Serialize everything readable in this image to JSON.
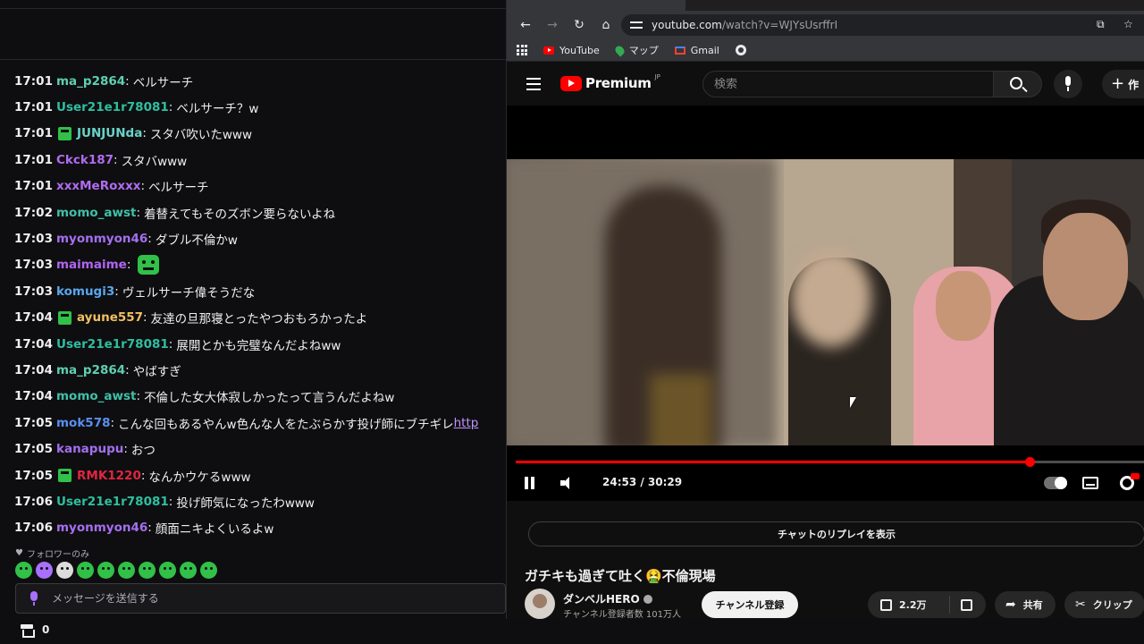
{
  "chat": {
    "messages": [
      {
        "time": "17:01",
        "user": "ma_p2864",
        "color": "#5fcfb0",
        "text": "ベルサーチ",
        "badge": false
      },
      {
        "time": "17:01",
        "user": "User21e1r78081",
        "color": "#2fbfa0",
        "text": "ベルサーチ？w",
        "badge": false
      },
      {
        "time": "17:01",
        "user": "JUNJUNda",
        "color": "#68d3c8",
        "text": "スタバ吹いたwww",
        "badge": true
      },
      {
        "time": "17:01",
        "user": "Ckck187",
        "color": "#b06cf0",
        "text": "スタバwww",
        "badge": false
      },
      {
        "time": "17:01",
        "user": "xxxMeRoxxx",
        "color": "#b06cf0",
        "text": "ベルサーチ",
        "badge": false
      },
      {
        "time": "17:02",
        "user": "momo_awst",
        "color": "#3fc0a8",
        "text": "着替えてもそのズボン要らないよね",
        "badge": false
      },
      {
        "time": "17:03",
        "user": "myonmyon46",
        "color": "#a56ff0",
        "text": "ダブル不倫かw",
        "badge": false
      },
      {
        "time": "17:03",
        "user": "maimaime",
        "color": "#b066f0",
        "text": "",
        "badge": false,
        "emote": true
      },
      {
        "time": "17:03",
        "user": "komugi3",
        "color": "#5aa7f0",
        "text": "ヴェルサーチ偉そうだな",
        "badge": false
      },
      {
        "time": "17:04",
        "user": "ayune557",
        "color": "#f0c060",
        "text": "友達の旦那寝とったやつおもろかったよ",
        "badge": true
      },
      {
        "time": "17:04",
        "user": "User21e1r78081",
        "color": "#2fbfa0",
        "text": "展開とかも完璧なんだよねww",
        "badge": false
      },
      {
        "time": "17:04",
        "user": "ma_p2864",
        "color": "#5fcfb0",
        "text": "やばすぎ",
        "badge": false
      },
      {
        "time": "17:04",
        "user": "momo_awst",
        "color": "#3fc0a8",
        "text": "不倫した女大体寂しかったって言うんだよねw",
        "badge": false
      },
      {
        "time": "17:05",
        "user": "mok578",
        "color": "#5a8ff0",
        "text": "こんな回もあるやんw色んな人をたぶらかす投げ師にブチギレ",
        "link": "http",
        "badge": false
      },
      {
        "time": "17:05",
        "user": "kanapupu",
        "color": "#a56ff0",
        "text": "おつ",
        "badge": false
      },
      {
        "time": "17:05",
        "user": "RMK1220",
        "color": "#e0263e",
        "text": "なんかウケるwww",
        "badge": true
      },
      {
        "time": "17:06",
        "user": "User21e1r78081",
        "color": "#2fbfa0",
        "text": "投げ師気になったわwww",
        "badge": false
      },
      {
        "time": "17:06",
        "user": "myonmyon46",
        "color": "#a56ff0",
        "text": "顔面ニキよくいるよw",
        "badge": false
      }
    ],
    "follower_only": "フォロワーのみ",
    "input_placeholder": "メッセージを送信する",
    "points": "0"
  },
  "browser": {
    "url_host": "youtube.com",
    "url_path": "/watch?v=WJYsUsrffrI",
    "bookmarks": [
      "YouTube",
      "マップ",
      "Gmail"
    ]
  },
  "youtube": {
    "logo_text": "Premium",
    "logo_region": "JP",
    "search_placeholder": "検索",
    "create_label": "作",
    "time_display": "24:53 / 30:29",
    "progress": 0.8162,
    "chat_replay_label": "チャットのリプレイを表示",
    "video_title": "ガチキも過ぎて吐く🤮不倫現場",
    "channel_name": "ダンベルHERO",
    "subscribers": "チャンネル登録者数 101万人",
    "subscribe_label": "チャンネル登録",
    "likes": "2.2万",
    "share_label": "共有",
    "clip_label": "クリップ"
  },
  "colors": {
    "accent_red": "#ff0000",
    "twitch_purple": "#a970ff",
    "badge_green": "#31c048"
  }
}
